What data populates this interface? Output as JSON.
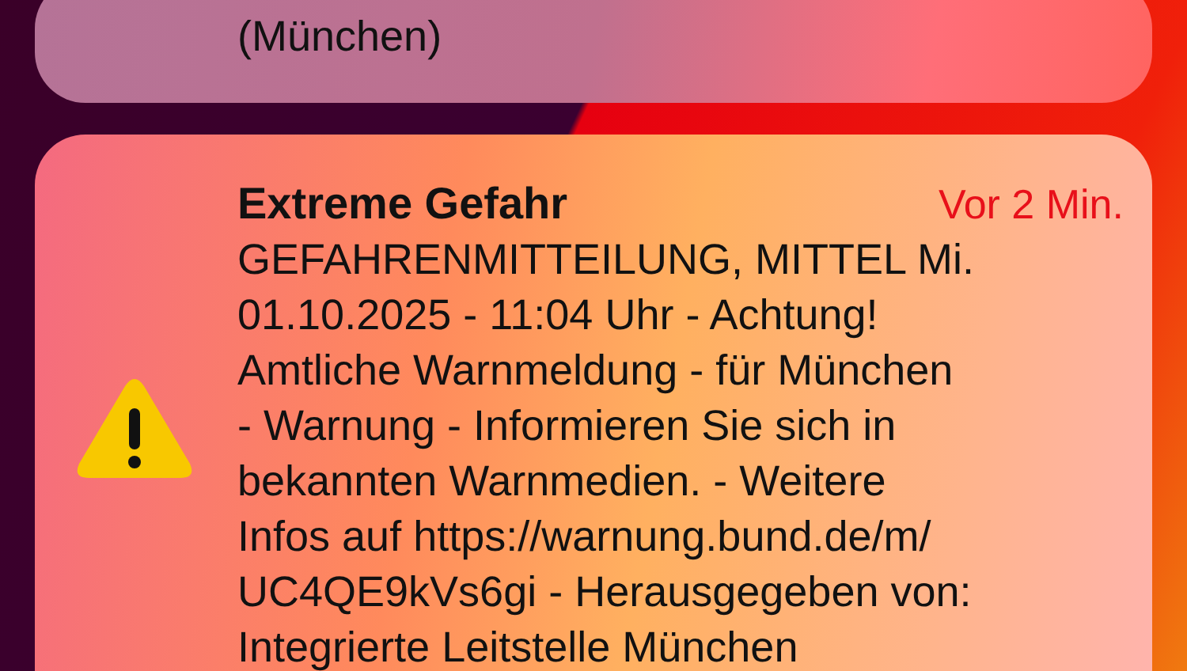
{
  "notifications": [
    {
      "kind": "plain",
      "lines": [
        "(München)"
      ]
    },
    {
      "title": "Extreme Gefahr",
      "time": "Vor 2 Min.",
      "kind": "warning",
      "lines": [
        "GEFAHRENMITTEILUNG, MITTEL Mi.",
        "01.10.2025 - 11:04 Uhr - Achtung!",
        "Amtliche Warnmeldung - für München",
        "- Warnung - Informieren Sie sich in",
        "bekannten Warnmedien. - Weitere",
        "Infos auf https://warnung.bund.de/m/",
        "UC4QE9kVs6gi - Herausgegeben von:",
        "Integrierte Leitstelle München"
      ]
    }
  ]
}
